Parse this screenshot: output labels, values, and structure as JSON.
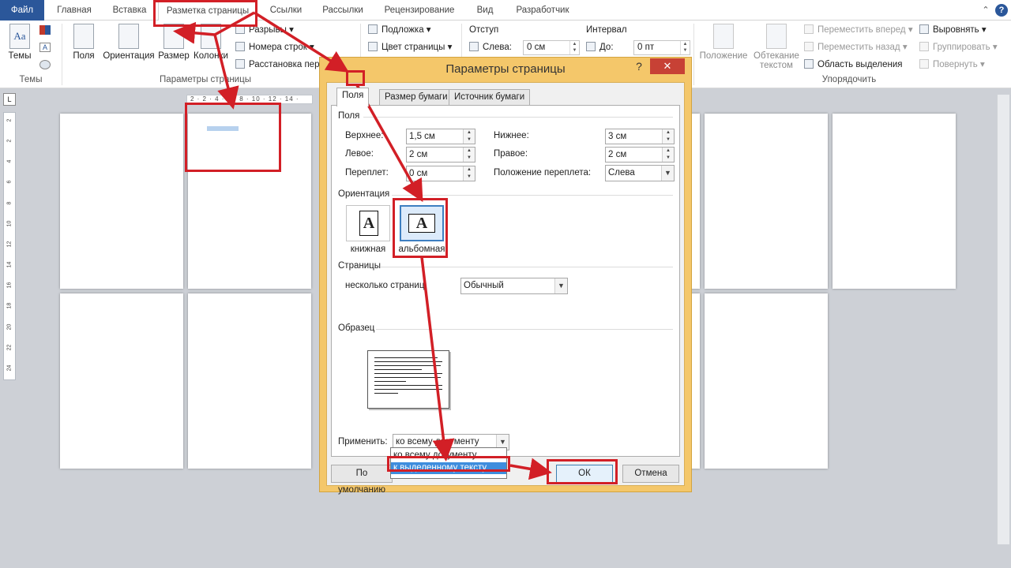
{
  "tabs": {
    "file": "Файл",
    "home": "Главная",
    "insert": "Вставка",
    "layout": "Разметка страницы",
    "references": "Ссылки",
    "mailings": "Рассылки",
    "review": "Рецензирование",
    "view": "Вид",
    "developer": "Разработчик",
    "help": "?"
  },
  "ribbon": {
    "themes": "Темы",
    "themes_group": "Темы",
    "margins": "Поля",
    "orientation": "Ориентация",
    "size": "Размер",
    "columns": "Колонки",
    "breaks": "Разрывы",
    "line_numbers": "Номера строк",
    "hyphenation": "Расстановка пер",
    "page_setup_group": "Параметры страницы",
    "watermark": "Подложка",
    "page_color": "Цвет страницы",
    "indent": "Отступ",
    "indent_left_label": "Слева:",
    "indent_left_value": "0 см",
    "spacing": "Интервал",
    "spacing_before_label": "До:",
    "spacing_before_value": "0 пт",
    "position": "Положение",
    "wrap_text": "Обтекание текстом",
    "bring_forward": "Переместить вперед",
    "send_backward": "Переместить назад",
    "selection_pane": "Область выделения",
    "align": "Выровнять",
    "group": "Группировать",
    "rotate": "Повернуть",
    "arrange_group": "Упорядочить"
  },
  "ruler": {
    "corner": "L",
    "h_ticks": "2 · 2 · 4 · 6 · 8 · 10 · 12 · 14 ·",
    "v_ticks": [
      "2",
      "2",
      "4",
      "6",
      "8",
      "10",
      "12",
      "14",
      "16",
      "18",
      "20",
      "22",
      "24"
    ]
  },
  "dialog": {
    "title": "Параметры страницы",
    "help": "?",
    "close": "✕",
    "tabs": [
      "Поля",
      "Размер бумаги",
      "Источник бумаги"
    ],
    "margins_section": "Поля",
    "top_label": "Верхнее:",
    "top_value": "1,5 см",
    "bottom_label": "Нижнее:",
    "bottom_value": "3 см",
    "left_label": "Левое:",
    "left_value": "2 см",
    "right_label": "Правое:",
    "right_value": "2 см",
    "gutter_label": "Переплет:",
    "gutter_value": "0 см",
    "gutter_pos_label": "Положение переплета:",
    "gutter_pos_value": "Слева",
    "orientation_section": "Ориентация",
    "portrait": "книжная",
    "landscape": "альбомная",
    "pages_section": "Страницы",
    "multiple_pages_label": "несколько страниц:",
    "multiple_pages_value": "Обычный",
    "preview_section": "Образец",
    "apply_label": "Применить:",
    "apply_value": "ко всему документу",
    "apply_options": [
      "ко всему документу",
      "к выделенному тексту"
    ],
    "default_button": "По умолчанию",
    "ok_button": "ОК",
    "cancel_button": "Отмена"
  },
  "colors": {
    "file_tab": "#2b579a",
    "annotation": "#d21f26",
    "dialog_frame": "#f4c76a",
    "highlight": "#3e8ddd"
  }
}
